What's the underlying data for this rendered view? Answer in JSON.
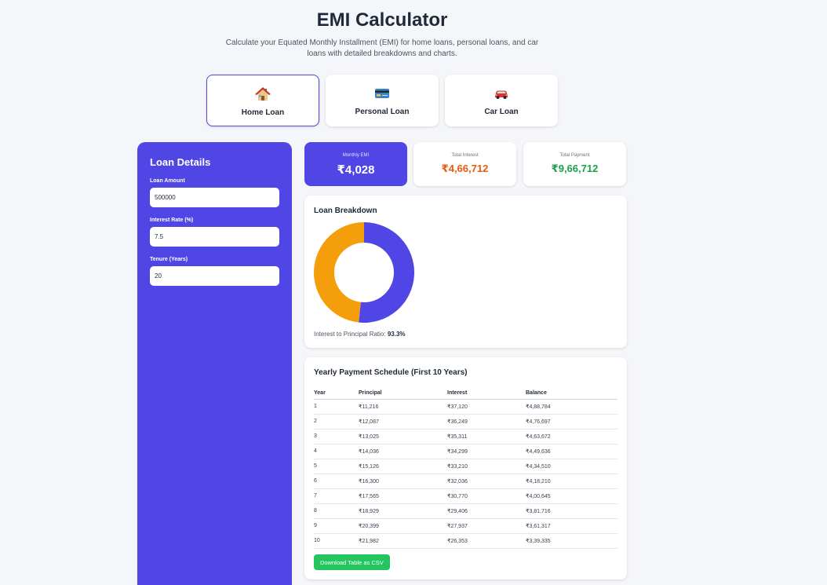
{
  "header": {
    "title": "EMI Calculator",
    "subtitle": "Calculate your Equated Monthly Installment (EMI) for home loans, personal loans, and car loans with detailed breakdowns and charts."
  },
  "loan_types": [
    {
      "label": "Home Loan",
      "icon": "house-icon",
      "active": true
    },
    {
      "label": "Personal Loan",
      "icon": "credit-card-icon",
      "active": false
    },
    {
      "label": "Car Loan",
      "icon": "car-icon",
      "active": false
    }
  ],
  "loan_details": {
    "title": "Loan Details",
    "amount_label": "Loan Amount",
    "amount_value": "500000",
    "rate_label": "Interest Rate (%)",
    "rate_value": "7.5",
    "tenure_label": "Tenure (Years)",
    "tenure_value": "20"
  },
  "summary": {
    "emi_label": "Monthly EMI",
    "emi_value": "₹4,028",
    "interest_label": "Total Interest",
    "interest_value": "₹4,66,712",
    "total_label": "Total Payment",
    "total_value": "₹9,66,712"
  },
  "breakdown": {
    "title": "Loan Breakdown",
    "ratio_label": "Interest to Principal Ratio:",
    "ratio_value": "93.3%",
    "principal": 500000,
    "interest": 466712,
    "colors": {
      "principal": "#4f46e5",
      "interest": "#f59e0b"
    }
  },
  "schedule": {
    "title": "Yearly Payment Schedule (First 10 Years)",
    "columns": [
      "Year",
      "Principal",
      "Interest",
      "Balance"
    ],
    "rows": [
      [
        "1",
        "₹11,216",
        "₹37,120",
        "₹4,88,784"
      ],
      [
        "2",
        "₹12,087",
        "₹36,249",
        "₹4,76,697"
      ],
      [
        "3",
        "₹13,025",
        "₹35,311",
        "₹4,63,672"
      ],
      [
        "4",
        "₹14,036",
        "₹34,299",
        "₹4,49,636"
      ],
      [
        "5",
        "₹15,126",
        "₹33,210",
        "₹4,34,510"
      ],
      [
        "6",
        "₹16,300",
        "₹32,036",
        "₹4,18,210"
      ],
      [
        "7",
        "₹17,565",
        "₹30,770",
        "₹4,00,645"
      ],
      [
        "8",
        "₹18,929",
        "₹29,406",
        "₹3,81,716"
      ],
      [
        "9",
        "₹20,399",
        "₹27,937",
        "₹3,61,317"
      ],
      [
        "10",
        "₹21,982",
        "₹26,353",
        "₹3,39,335"
      ]
    ],
    "download_label": "Download Table as CSV"
  }
}
